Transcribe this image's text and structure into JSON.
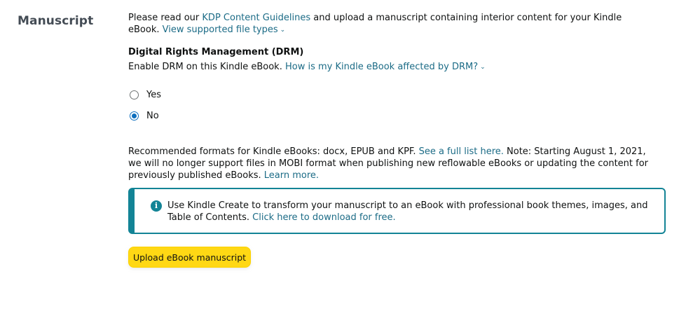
{
  "section": {
    "title": "Manuscript"
  },
  "intro": {
    "text_before": "Please read our ",
    "guidelines_link": "KDP Content Guidelines",
    "text_after": " and upload a manuscript containing interior content for your Kindle eBook. ",
    "file_types_link": "View supported file types"
  },
  "drm": {
    "heading": "Digital Rights Management (DRM)",
    "description": "Enable DRM on this Kindle eBook. ",
    "help_link": "How is my Kindle eBook affected by DRM?",
    "options": [
      {
        "label": "Yes",
        "checked": false
      },
      {
        "label": "No",
        "checked": true
      }
    ]
  },
  "formats": {
    "text_before": "Recommended formats for Kindle eBooks: docx, EPUB and KPF. ",
    "full_list_link": "See a full list here.",
    "text_middle": " Note: Starting August 1, 2021, we will no longer support files in MOBI format when publishing new reflowable eBooks or updating the content for previously published eBooks. ",
    "learn_more_link": "Learn more."
  },
  "info_box": {
    "icon": "info-icon",
    "text": "Use Kindle Create to transform your manuscript to an eBook with professional book themes, images, and Table of Contents. ",
    "download_link": "Click here to download for free."
  },
  "upload_button": {
    "label": "Upload eBook manuscript"
  },
  "colors": {
    "link": "#1b6b86",
    "accent": "#138496",
    "button": "#ffd814",
    "radio_selected": "#0d6ebd"
  }
}
